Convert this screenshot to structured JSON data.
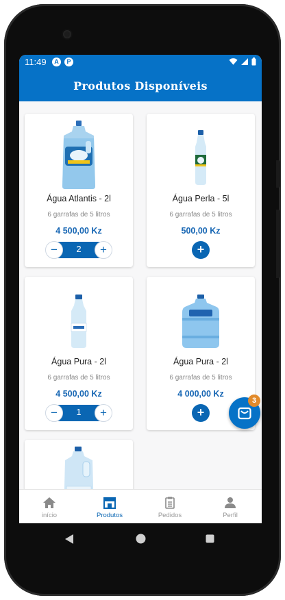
{
  "status_bar": {
    "time": "11:49",
    "app_icons": [
      "A",
      "P"
    ]
  },
  "app_bar": {
    "title": "Produtos Disponíveis"
  },
  "products": [
    {
      "name": "Água Atlantis - 2l",
      "desc": "6 garrafas de 5 litros",
      "price": "4 500,00 Kz",
      "quantity": "2",
      "image": "large-gallon-bottle-icon"
    },
    {
      "name": "Água Perla - 5l",
      "desc": "6 garrafas de 5 litros",
      "price": "500,00 Kz",
      "image": "slim-bottle-icon"
    },
    {
      "name": "Água Pura - 2l",
      "desc": "6 garrafas de 5 litros",
      "price": "4 500,00 Kz",
      "quantity": "1",
      "image": "small-bottle-icon"
    },
    {
      "name": "Água Pura - 2l",
      "desc": "6 garrafas de 5 litros",
      "price": "4 000,00 Kz",
      "image": "water-cooler-jug-icon"
    },
    {
      "image": "handle-jug-icon"
    }
  ],
  "cart": {
    "badge": "3"
  },
  "bottom_nav": [
    {
      "label": "início",
      "icon": "home-icon"
    },
    {
      "label": "Produtos",
      "icon": "store-icon",
      "active": true
    },
    {
      "label": "Pedidos",
      "icon": "clipboard-icon"
    },
    {
      "label": "Perfil",
      "icon": "person-icon"
    }
  ],
  "colors": {
    "primary": "#0672c7",
    "stepper": "#0a66b3",
    "price": "#1867b4",
    "badge": "#e28a2a"
  }
}
